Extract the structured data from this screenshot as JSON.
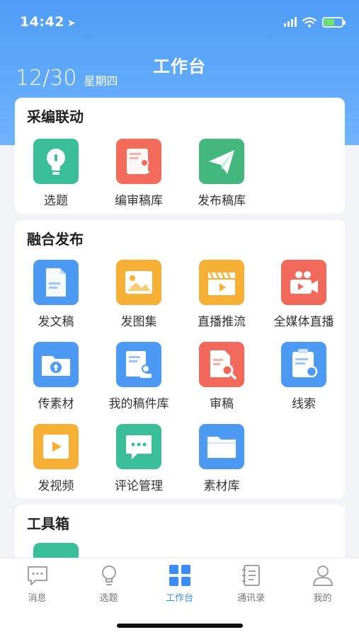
{
  "status_bar": {
    "time": "14:42"
  },
  "header": {
    "title": "工作台",
    "date": "12/30",
    "weekday": "星期四"
  },
  "sections": [
    {
      "title": "采编联动",
      "items": [
        {
          "label": "选题",
          "icon": "lightbulb-icon",
          "color": "#3bbf9b"
        },
        {
          "label": "编审稿库",
          "icon": "editor-document-icon",
          "color": "#f26b5b"
        },
        {
          "label": "发布稿库",
          "icon": "paper-plane-icon",
          "color": "#43b77d"
        }
      ]
    },
    {
      "title": "融合发布",
      "items": [
        {
          "label": "发文稿",
          "icon": "document-icon",
          "color": "#4d9af5"
        },
        {
          "label": "发图集",
          "icon": "image-icon",
          "color": "#f6b036"
        },
        {
          "label": "直播推流",
          "icon": "clapperboard-icon",
          "color": "#f6b036"
        },
        {
          "label": "全媒体直播",
          "icon": "video-camera-icon",
          "color": "#f2685a"
        },
        {
          "label": "传素材",
          "icon": "cloud-upload-folder-icon",
          "color": "#4d9af5"
        },
        {
          "label": "我的稿件库",
          "icon": "document-stamp-icon",
          "color": "#4d9af5"
        },
        {
          "label": "审稿",
          "icon": "document-search-icon",
          "color": "#f2685a"
        },
        {
          "label": "线索",
          "icon": "clipboard-clue-icon",
          "color": "#4d9af5"
        },
        {
          "label": "发视频",
          "icon": "video-play-icon",
          "color": "#f6b036"
        },
        {
          "label": "评论管理",
          "icon": "comment-bubble-icon",
          "color": "#3bbf9b"
        },
        {
          "label": "素材库",
          "icon": "folder-icon",
          "color": "#4d9af5"
        }
      ]
    },
    {
      "title": "工具箱",
      "items": []
    }
  ],
  "tabbar": [
    {
      "label": "消息",
      "icon": "message-icon",
      "active": false
    },
    {
      "label": "选题",
      "icon": "lightbulb-icon",
      "active": false
    },
    {
      "label": "工作台",
      "icon": "grid-icon",
      "active": true
    },
    {
      "label": "通讯录",
      "icon": "contacts-book-icon",
      "active": false
    },
    {
      "label": "我的",
      "icon": "user-icon",
      "active": false
    }
  ],
  "colors": {
    "brand": "#3b8cf5",
    "inactive": "#9a9a9a"
  }
}
